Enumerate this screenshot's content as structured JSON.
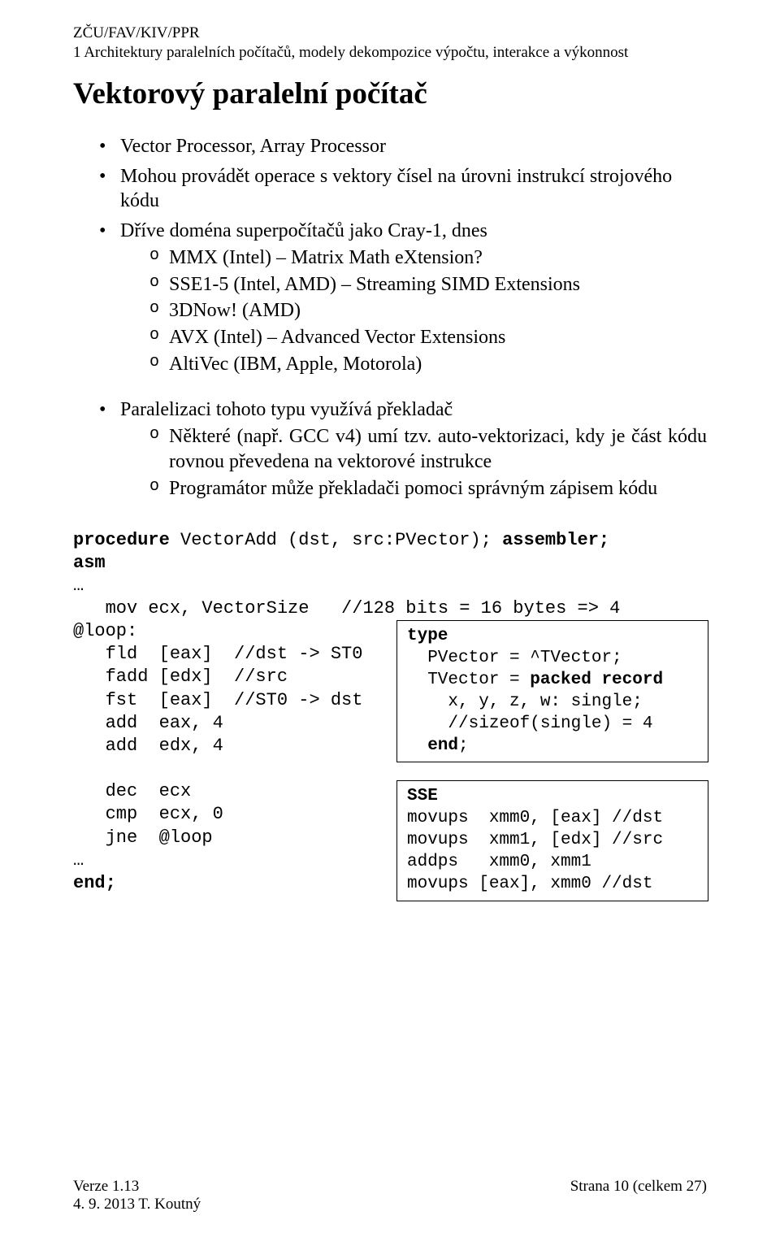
{
  "header": {
    "line1": "ZČU/FAV/KIV/PPR",
    "line2": "1 Architektury paralelních počítačů, modely dekompozice výpočtu, interakce a výkonnost"
  },
  "title": "Vektorový paralelní počítač",
  "bullets": {
    "b1": "Vector Processor, Array Processor",
    "b2": "Mohou provádět operace s vektory čísel na úrovni instrukcí strojového kódu",
    "b3": "Dříve doména superpočítačů jako Cray-1, dnes",
    "b3_sub": {
      "s1": "MMX (Intel) – Matrix Math eXtension?",
      "s2": "SSE1-5 (Intel, AMD) – Streaming SIMD Extensions",
      "s3": "3DNow! (AMD)",
      "s4": "AVX (Intel) – Advanced Vector Extensions",
      "s5": "AltiVec (IBM, Apple, Motorola)"
    },
    "b4": "Paralelizaci tohoto typu využívá překladač",
    "b4_sub": {
      "s1": "Některé (např. GCC v4) umí tzv. auto-vektorizaci, kdy je část kódu rovnou převedena na vektorové instrukce",
      "s2": "Programátor může překladači pomoci správným zápisem kódu"
    }
  },
  "code": {
    "proc_pre": "procedure",
    "proc_mid": " VectorAdd (dst, src:PVector); ",
    "proc_post": "assembler;",
    "asm": "asm",
    "ell1": "…",
    "mov": "   mov ecx, VectorSize   //128 bits = 16 bytes => 4",
    "loop": "@loop:",
    "fld": "   fld  [eax]  //dst -> ST0",
    "fadd": "   fadd [edx]  //src",
    "fst": "   fst  [eax]  //ST0 -> dst",
    "add1": "   add  eax, 4",
    "add2": "   add  edx, 4",
    "blank": "",
    "dec": "   dec  ecx",
    "cmp": "   cmp  ecx, 0",
    "jne": "   jne  @loop",
    "ell2": "…",
    "end": "end;"
  },
  "box1": {
    "l1a": "type",
    "l2a": "  PVector = ^TVector;",
    "l3a_pre": "  TVector = ",
    "l3a_kw": "packed record",
    "l4a": "    x, y, z, w: single;",
    "l5a": "    //sizeof(single) = 4",
    "l6a_kw": "  end",
    "l6a_post": ";"
  },
  "box2": {
    "l1b": "SSE",
    "l2b": "movups  xmm0, [eax] //dst",
    "l3b": "movups  xmm1, [edx] //src",
    "l4b": "addps   xmm0, xmm1",
    "l5b": "movups [eax], xmm0 //dst"
  },
  "footer": {
    "left1": "Verze 1.13",
    "left2": "4. 9. 2013 T. Koutný",
    "right": "Strana 10 (celkem 27)"
  }
}
